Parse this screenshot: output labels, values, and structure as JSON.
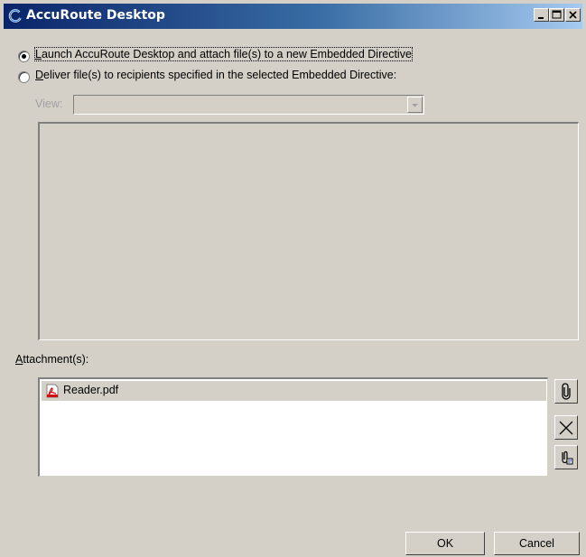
{
  "window": {
    "title": "AccuRoute Desktop",
    "minimize_icon": "minimize-icon",
    "maximize_icon": "maximize-icon",
    "close_icon": "close-icon"
  },
  "options": {
    "launch_label": "Launch AccuRoute Desktop and attach file(s) to a new Embedded Directive",
    "launch_access_key": "L",
    "launch_selected": true,
    "deliver_label": "Deliver file(s) to recipients specified in the selected Embedded Directive:",
    "deliver_access_key": "D",
    "deliver_selected": false
  },
  "view": {
    "label": "View:",
    "value": ""
  },
  "attachments": {
    "label": "Attachment(s):",
    "access_key": "A",
    "items": [
      {
        "name": "Reader.pdf",
        "icon": "pdf-file-icon"
      }
    ],
    "add_button_icon": "paperclip-icon",
    "remove_button_icon": "delete-x-icon",
    "attach_open_button_icon": "attach-document-icon"
  },
  "buttons": {
    "ok": "OK",
    "cancel": "Cancel"
  },
  "colors": {
    "title_gradient_start": "#0a246a",
    "title_gradient_end": "#a6caf0",
    "face": "#d4d0c8"
  }
}
